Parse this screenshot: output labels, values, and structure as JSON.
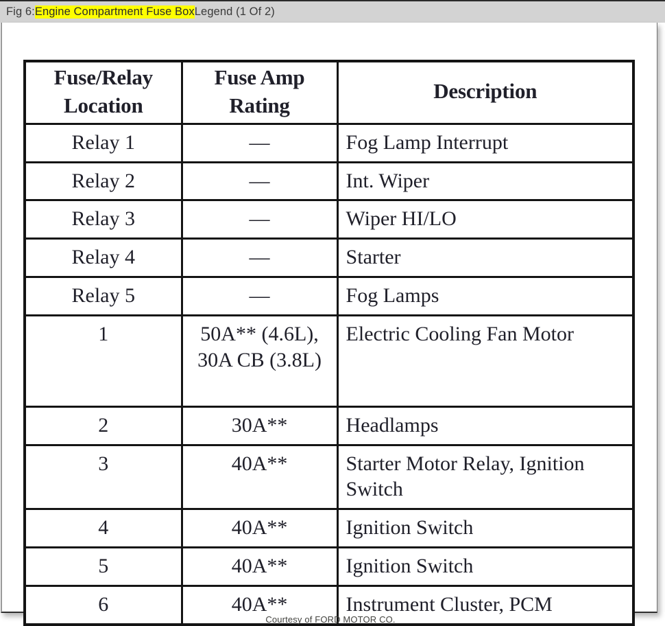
{
  "caption": {
    "prefix": "Fig 6: ",
    "highlighted": "Engine Compartment Fuse Box",
    "suffix": " Legend (1 Of 2)",
    "highlight_color": "#ffff00",
    "bar_background": "#d3d3d3"
  },
  "table": {
    "headers": {
      "location": "Fuse/Relay\nLocation",
      "location_line1": "Fuse/Relay",
      "location_line2": "Location",
      "amp_line1": "Fuse Amp",
      "amp_line2": "Rating",
      "description": "Description"
    },
    "rows": [
      {
        "location": "Relay 1",
        "amp": "—",
        "description": "Fog Lamp Interrupt"
      },
      {
        "location": "Relay 2",
        "amp": "—",
        "description": "Int. Wiper"
      },
      {
        "location": "Relay 3",
        "amp": "—",
        "description": "Wiper HI/LO"
      },
      {
        "location": "Relay 4",
        "amp": "—",
        "description": "Starter"
      },
      {
        "location": "Relay 5",
        "amp": "—",
        "description": "Fog Lamps"
      },
      {
        "location": "1",
        "amp": "50A** (4.6L), 30A CB (3.8L)",
        "description": "Electric Cooling Fan Motor"
      },
      {
        "location": "2",
        "amp": "30A**",
        "description": "Headlamps"
      },
      {
        "location": "3",
        "amp": "40A**",
        "description": "Starter Motor Relay, Ignition Switch"
      },
      {
        "location": "4",
        "amp": "40A**",
        "description": "Ignition Switch"
      },
      {
        "location": "5",
        "amp": "40A**",
        "description": "Ignition Switch"
      },
      {
        "location": "6",
        "amp": "40A**",
        "description": "Instrument Cluster, PCM"
      }
    ]
  },
  "credit": "Courtesy of FORD MOTOR CO."
}
